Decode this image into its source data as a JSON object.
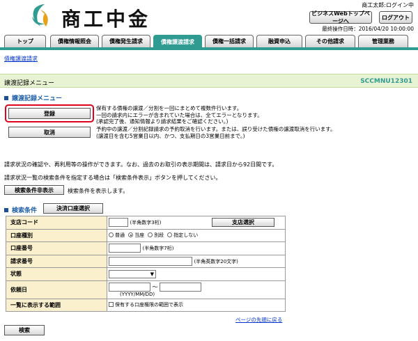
{
  "header": {
    "app_title": "商工中金",
    "user_label": "商工太郎:ログイン中",
    "top_page_button": "ビジネスWebトップページへ",
    "logout_button": "ログアウト",
    "last_operation": "最終操作日時：2016/04/20 10:00:00"
  },
  "tabs": [
    {
      "label": "トップ",
      "active": false
    },
    {
      "label": "債権情報照会",
      "active": false
    },
    {
      "label": "債権発生請求",
      "active": false
    },
    {
      "label": "債権譲渡請求",
      "active": true
    },
    {
      "label": "債権一括請求",
      "active": false
    },
    {
      "label": "融資申込",
      "active": false
    },
    {
      "label": "その他請求",
      "active": false
    },
    {
      "label": "管理業務",
      "active": false
    }
  ],
  "breadcrumb": "債権譲渡請求",
  "title_bar": {
    "title": "譲渡記録メニュー",
    "screen_id": "SCCMNU12301"
  },
  "menu_section": {
    "heading": "譲渡記録メニュー",
    "register_button": "登録",
    "register_desc": [
      "保有する債権の譲渡／分割を一回にまとめて複数件行います。",
      "一回の請求内にエラーが含まれていた場合は、全てエラーとなります。",
      "(承認完了後、通知情報より請求結果をご確認ください。)"
    ],
    "cancel_button": "取消",
    "cancel_desc": [
      "予約中の譲渡／分割記録請求の予約取消を行います。または、誤り受けた債権の譲渡取消を行います。",
      "(譲渡日を含む5営業日以内、かつ、支払期日の3営業日前まで。)"
    ]
  },
  "status_info": [
    "請求状況の確認や、再利用等の操作ができます。なお、過去のお取引の表示期間は、請求日から92日間です。",
    "請求状況一覧の検索条件を指定する場合は「検索条件表示」ボタンを押してください。"
  ],
  "toggle_search": {
    "button": "検索条件非表示",
    "desc": "検索条件を表示します。"
  },
  "search": {
    "heading": "検索条件",
    "settlement_account_button": "決済口座選択",
    "rows": {
      "branch_code": {
        "label": "支店コード",
        "hint": "(半角数字3桁)",
        "button": "支店選択"
      },
      "account_type": {
        "label": "口座種別",
        "options": [
          "普通",
          "当座",
          "別段",
          "指定しない"
        ],
        "selected": "当座"
      },
      "account_number": {
        "label": "口座番号",
        "hint": "(半角数字7桁)"
      },
      "request_number": {
        "label": "請求番号",
        "hint": "(半角英数字20文字)"
      },
      "status": {
        "label": "状態",
        "selected": ""
      },
      "request_date": {
        "label": "依頼日",
        "separator": "〜",
        "hint": "(YYYY/MM/DD)"
      },
      "display_scope": {
        "label": "一覧に表示する範囲",
        "checkbox": "保有する口座権限の範囲で表示"
      }
    },
    "search_button": "検索"
  },
  "back_to_top_link": "ページの先頭に戻る",
  "colors": {
    "accent": "#2f9b91",
    "highlight": "#e0001b",
    "label_bg": "#fbf0cd",
    "title_bg": "#e8f3d3",
    "link": "#0033cc"
  }
}
